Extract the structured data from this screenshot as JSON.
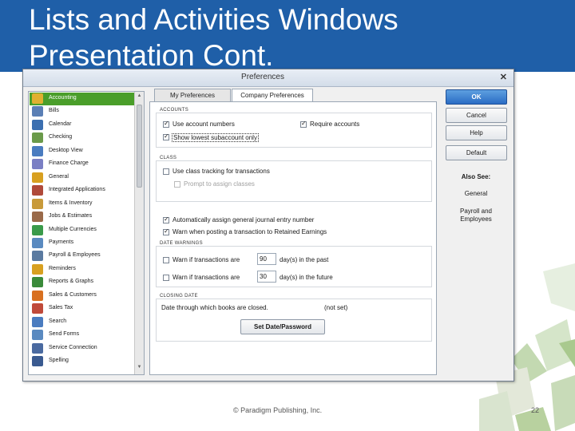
{
  "slide": {
    "title_line1": "Lists and Activities Windows",
    "title_line2": "Presentation Cont.",
    "footer_copyright": "© Paradigm Publishing, Inc.",
    "page_number": "22",
    "header_color": "#1f5fa8"
  },
  "dialog": {
    "title": "Preferences",
    "close": "✕",
    "sidebar": {
      "selected": "Accounting",
      "items": [
        {
          "label": "Accounting",
          "icon": "accounting-icon",
          "color": "#e0b030"
        },
        {
          "label": "Bills",
          "icon": "bills-icon",
          "color": "#5a7fb5"
        },
        {
          "label": "Calendar",
          "icon": "calendar-icon",
          "color": "#3b6fb0"
        },
        {
          "label": "Checking",
          "icon": "checking-icon",
          "color": "#6a9a4a"
        },
        {
          "label": "Desktop View",
          "icon": "desktop-icon",
          "color": "#4a7cc0"
        },
        {
          "label": "Finance Charge",
          "icon": "finance-charge-icon",
          "color": "#7a7fc4"
        },
        {
          "label": "General",
          "icon": "general-icon",
          "color": "#d8a020"
        },
        {
          "label": "Integrated Applications",
          "icon": "integrated-apps-icon",
          "color": "#b04a3a"
        },
        {
          "label": "Items & Inventory",
          "icon": "items-icon",
          "color": "#c89a3a"
        },
        {
          "label": "Jobs & Estimates",
          "icon": "jobs-icon",
          "color": "#9a6a4a"
        },
        {
          "label": "Multiple Currencies",
          "icon": "currencies-icon",
          "color": "#3a9a4a"
        },
        {
          "label": "Payments",
          "icon": "payments-icon",
          "color": "#5a8ac0"
        },
        {
          "label": "Payroll & Employees",
          "icon": "payroll-icon",
          "color": "#5a7aa0"
        },
        {
          "label": "Reminders",
          "icon": "reminders-icon",
          "color": "#d8a020"
        },
        {
          "label": "Reports & Graphs",
          "icon": "reports-icon",
          "color": "#3a8a3a"
        },
        {
          "label": "Sales & Customers",
          "icon": "sales-icon",
          "color": "#d87020"
        },
        {
          "label": "Sales Tax",
          "icon": "sales-tax-icon",
          "color": "#c04a3a"
        },
        {
          "label": "Search",
          "icon": "search-icon",
          "color": "#4a7cc0"
        },
        {
          "label": "Send Forms",
          "icon": "send-forms-icon",
          "color": "#5a8ac0"
        },
        {
          "label": "Service Connection",
          "icon": "service-connection-icon",
          "color": "#4a6aa0"
        },
        {
          "label": "Spelling",
          "icon": "spelling-icon",
          "color": "#3a5a90"
        }
      ]
    },
    "tabs": [
      {
        "label": "My Preferences"
      },
      {
        "label": "Company Preferences"
      }
    ],
    "active_tab": "Company Preferences",
    "accounts": {
      "legend": "ACCOUNTS",
      "use_account_numbers": "Use account numbers",
      "show_lowest_subaccount": "Show lowest subaccount only",
      "require_accounts": "Require accounts"
    },
    "class": {
      "legend": "CLASS",
      "use_class_tracking": "Use class tracking for transactions",
      "prompt_assign": "Prompt to assign classes"
    },
    "auto_assign": "Automatically assign general journal entry number",
    "warn_retained": "Warn when posting a transaction to Retained Earnings",
    "date_warnings": {
      "legend": "DATE WARNINGS",
      "warn_past_prefix": "Warn if transactions are",
      "past_days": "90",
      "past_suffix": "day(s) in the past",
      "warn_future_prefix": "Warn if transactions are",
      "future_days": "30",
      "future_suffix": "day(s) in the future"
    },
    "closing_date": {
      "legend": "CLOSING DATE",
      "text": "Date through which books are closed.",
      "value": "(not set)",
      "button": "Set Date/Password"
    },
    "buttons": {
      "ok": "OK",
      "cancel": "Cancel",
      "help": "Help",
      "default": "Default"
    },
    "also_see": {
      "heading": "Also See:",
      "general": "General",
      "payroll_line1": "Payroll and",
      "payroll_line2": "Employees"
    }
  }
}
